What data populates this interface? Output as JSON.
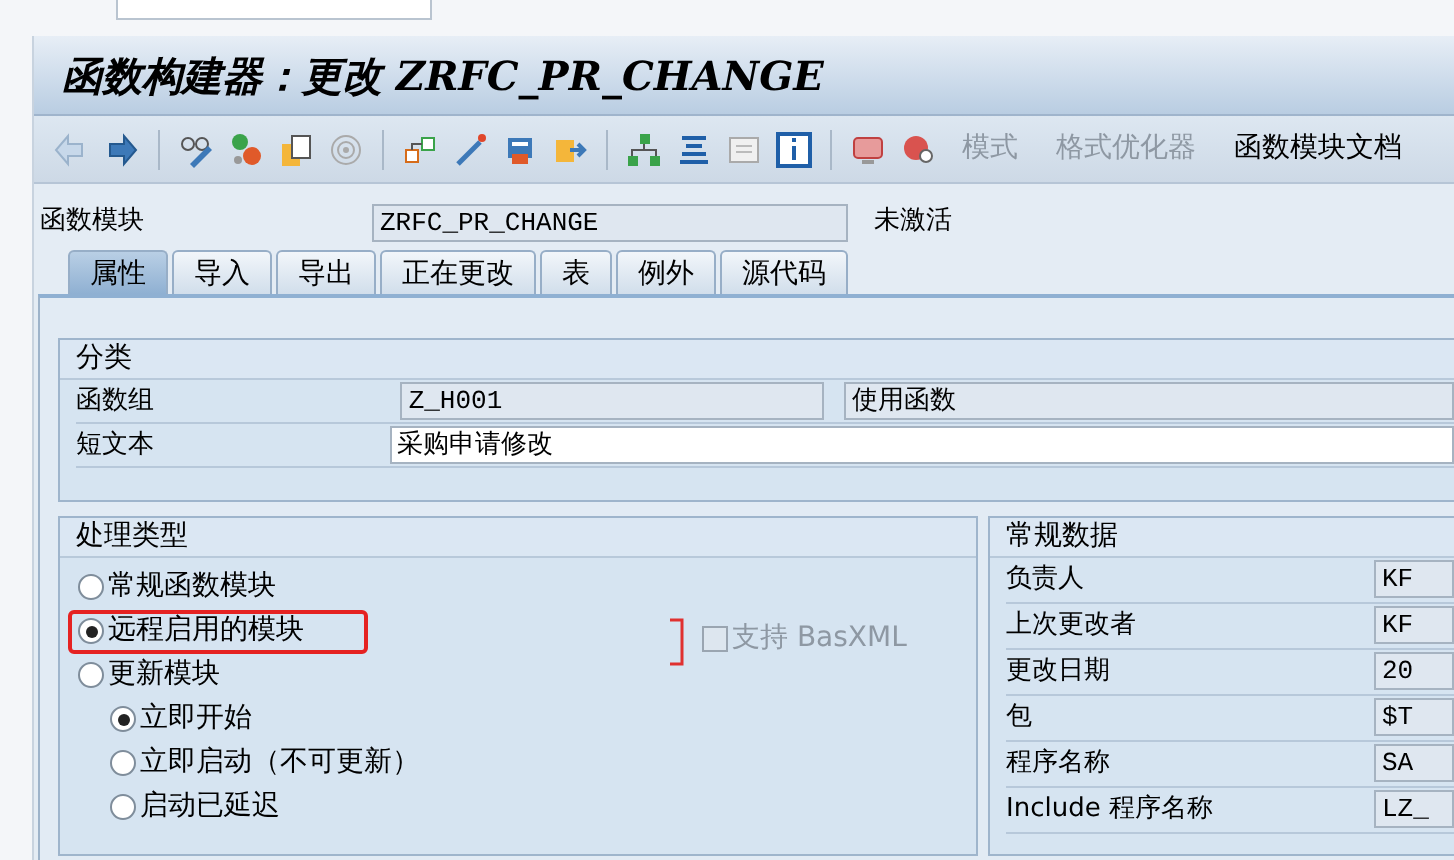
{
  "title": "函数构建器：更改 ZRFC_PR_CHANGE",
  "toolbar_buttons": [
    {
      "label": "模式",
      "disabled": true
    },
    {
      "label": "格式优化器",
      "disabled": true
    },
    {
      "label": "函数模块文档",
      "disabled": false
    }
  ],
  "header": {
    "label": "函数模块",
    "value": "ZRFC_PR_CHANGE",
    "status": "未激活"
  },
  "tabs": [
    {
      "label": "属性",
      "selected": true
    },
    {
      "label": "导入",
      "selected": false
    },
    {
      "label": "导出",
      "selected": false
    },
    {
      "label": "正在更改",
      "selected": false
    },
    {
      "label": "表",
      "selected": false
    },
    {
      "label": "例外",
      "selected": false
    },
    {
      "label": "源代码",
      "selected": false
    }
  ],
  "classification": {
    "title": "分类",
    "rows": [
      {
        "label": "函数组",
        "value": "Z_H001",
        "description": "使用函数",
        "readonly": true
      },
      {
        "label": "短文本",
        "value": "采购申请修改",
        "readonly": false
      }
    ]
  },
  "processing_type": {
    "title": "处理类型",
    "options": [
      {
        "label": "常规函数模块",
        "selected": false,
        "highlighted": false
      },
      {
        "label": "远程启用的模块",
        "selected": true,
        "highlighted": true
      },
      {
        "label": "更新模块",
        "selected": false,
        "highlighted": false,
        "children": [
          {
            "label": "立即开始",
            "selected": true
          },
          {
            "label": "立即启动（不可更新）",
            "selected": false
          },
          {
            "label": "启动已延迟",
            "selected": false
          }
        ]
      }
    ],
    "basxml": {
      "label": "支持 BasXML",
      "checked": false,
      "disabled": true
    }
  },
  "general_data": {
    "title": "常规数据",
    "rows": [
      {
        "label": "负责人",
        "value": "KF"
      },
      {
        "label": "上次更改者",
        "value": "KF"
      },
      {
        "label": "更改日期",
        "value": "20"
      },
      {
        "label": "包",
        "value": "$T"
      },
      {
        "label": "程序名称",
        "value": "SA"
      },
      {
        "label": "Include 程序名称",
        "value": "LZ_"
      }
    ]
  }
}
